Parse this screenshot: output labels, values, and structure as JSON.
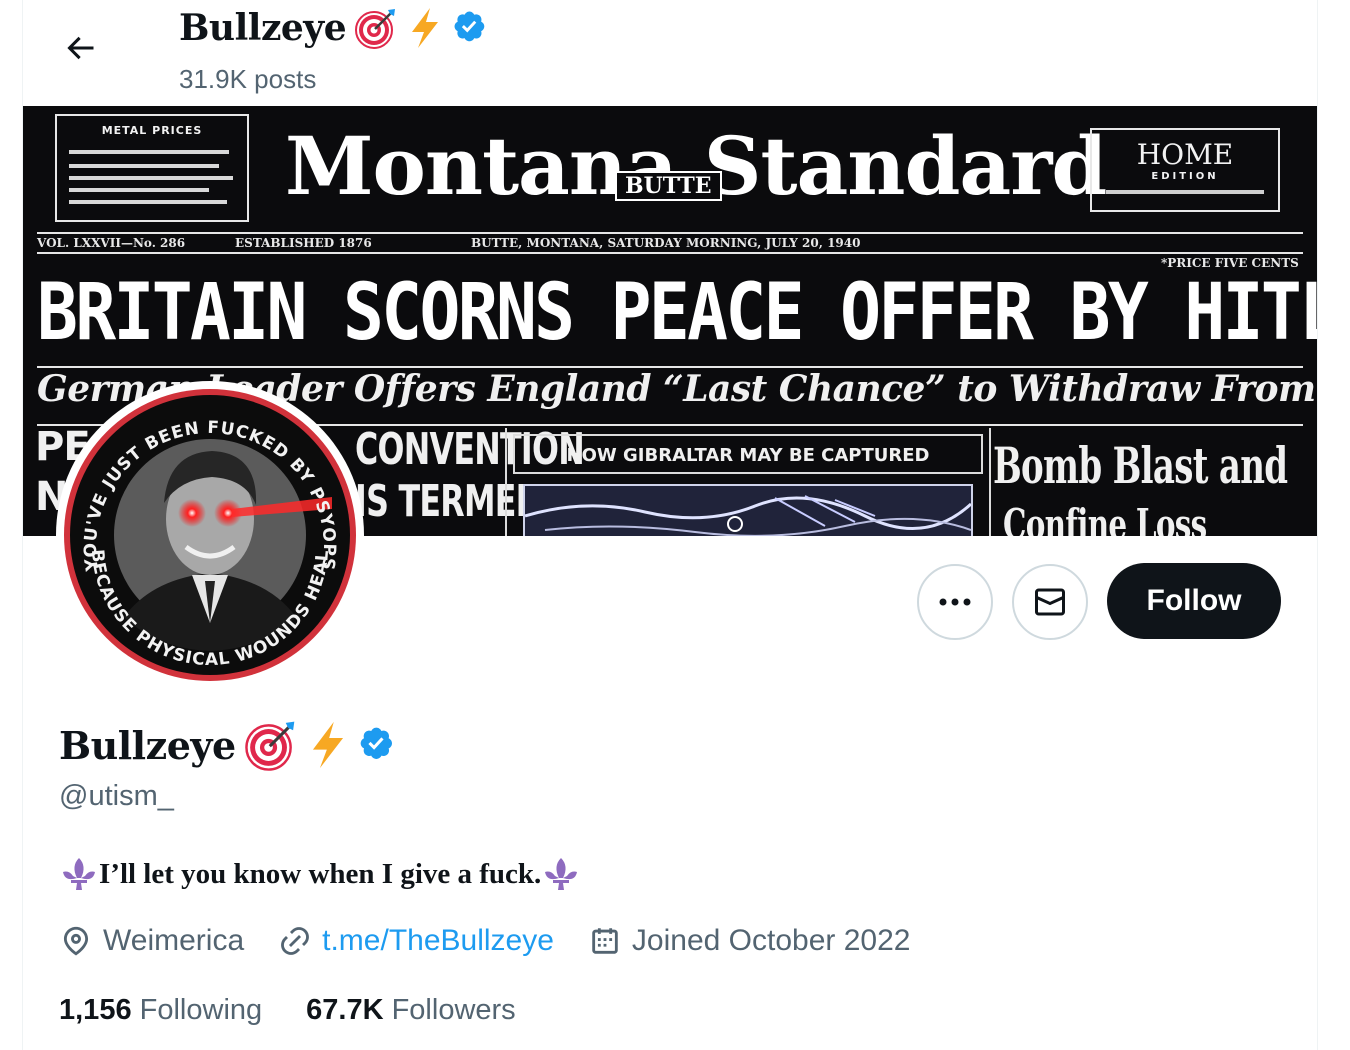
{
  "header": {
    "name": "Bullzeye",
    "posts": "31.9K posts"
  },
  "banner": {
    "metal_prices": "METAL PRICES",
    "masthead": "Montana Standard",
    "butte": "BUTTE",
    "home": "HOME",
    "edition": "EDITION",
    "vol": "VOL. LXXVII—No. 286",
    "established": "ESTABLISHED 1876",
    "dateline": "BUTTE, MONTANA, SATURDAY MORNING, JULY 20, 1940",
    "price": "*PRICE FIVE CENTS",
    "headline": "BRITAIN SCORNS PEACE OFFER BY HITLER",
    "subhead": "German Leader Offers England “Last Chance” to Withdraw From Conflict",
    "col_left_1": "PEACE",
    "col_left_2": "NO",
    "convention": "CONVENTION",
    "termed": "IS TERMED",
    "gibraltar": "HOW GIBRALTAR MAY BE CAPTURED",
    "bomb": "Bomb Blast and",
    "bomb2": "Confine Loss"
  },
  "avatar": {
    "ring_top": "YOU'VE JUST BEEN FUCKED BY PSYOPS",
    "ring_bottom": "BECAUSE PHYSICAL WOUNDS HEAL"
  },
  "actions": {
    "follow": "Follow"
  },
  "profile": {
    "name": "Bullzeye",
    "handle": "@utism_",
    "bio": "I’ll let you know when I give a fuck.",
    "location": "Weimerica",
    "link": "t.me/TheBullzeye",
    "joined": "Joined October 2022",
    "following_count": "1,156",
    "following_label": "Following",
    "followers_count": "67.7K",
    "followers_label": "Followers"
  },
  "icons": {
    "back": "arrow-left-icon",
    "target": "direct-hit-emoji",
    "bolt": "high-voltage-emoji",
    "verified": "verified-badge-icon",
    "more": "more-dots-icon",
    "message": "envelope-icon",
    "location": "location-pin-icon",
    "link": "link-icon",
    "calendar": "calendar-icon",
    "fleur": "fleur-de-lis-emoji"
  },
  "colors": {
    "verified": "#1d9bf0",
    "link": "#1d9bf0",
    "secondary_text": "#536471",
    "primary_text": "#0f1419",
    "follow_bg": "#0f1419"
  }
}
